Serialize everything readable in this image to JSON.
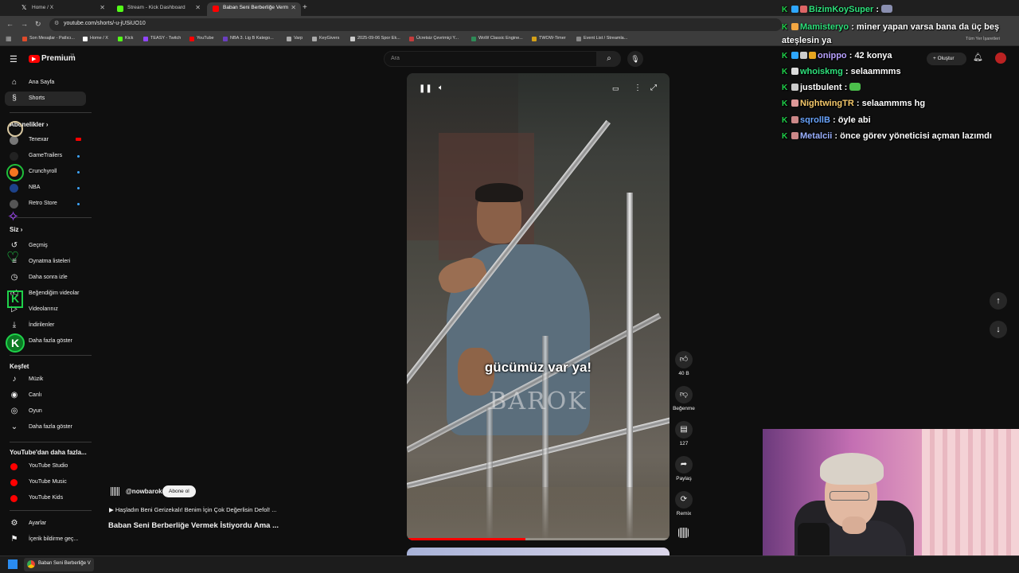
{
  "browser": {
    "tabs": [
      {
        "label": "Home / X",
        "color": "#ffffff"
      },
      {
        "label": "Stream - Kick Dashboard",
        "color": "#53fc18"
      },
      {
        "label": "Baban Seni Berberliğe Verm",
        "color": "#ff0000"
      }
    ],
    "url": "youtube.com/shorts/-u-jUSiUO10",
    "bookmarks": [
      {
        "label": "Son Mesajlar - Patlıcı...",
        "color": "#e04b2b"
      },
      {
        "label": "Home / X",
        "color": "#ffffff"
      },
      {
        "label": "Kick",
        "color": "#53fc18"
      },
      {
        "label": "TEASY - Twitch",
        "color": "#9146ff"
      },
      {
        "label": "YouTube",
        "color": "#ff0000"
      },
      {
        "label": "NBA 3. Lig B Katego...",
        "color": "#6a3fbf"
      },
      {
        "label": "Varp",
        "color": "#aaaaaa"
      },
      {
        "label": "KeyGivers",
        "color": "#aaaaaa"
      },
      {
        "label": "2025-09-06 Spor Ek...",
        "color": "#cccccc"
      },
      {
        "label": "Ücretsiz Çevrimiçi Y...",
        "color": "#c43c3c"
      },
      {
        "label": "WoW Classic Engine...",
        "color": "#2e8b57"
      },
      {
        "label": "TWOW-Timer",
        "color": "#d4a017"
      },
      {
        "label": "Event List / Streamla...",
        "color": "#888888"
      }
    ],
    "other_bookmarks": "Tüm Yer İşaretleri"
  },
  "youtube": {
    "logo": "Premium",
    "logo_sup": "TR",
    "search_placeholder": "Ara",
    "create_label": "Oluştur",
    "nav": [
      {
        "label": "Ana Sayfa",
        "icon": "home-icon"
      },
      {
        "label": "Shorts",
        "icon": "shorts-icon"
      }
    ],
    "subscriptions_heading": "Abonelikler",
    "subscriptions": [
      {
        "label": "Tenexar",
        "color": "#777777",
        "live": true
      },
      {
        "label": "GameTrailers",
        "color": "#222222",
        "live": false
      },
      {
        "label": "Crunchyroll",
        "color": "#f47521",
        "live": false
      },
      {
        "label": "NBA",
        "color": "#1d428a",
        "live": false
      },
      {
        "label": "Retro Store",
        "color": "#555555",
        "live": false
      }
    ],
    "you_heading": "Siz",
    "you_items": [
      {
        "label": "Geçmiş",
        "icon": "history-icon"
      },
      {
        "label": "Oynatma listeleri",
        "icon": "playlist-icon"
      },
      {
        "label": "Daha sonra izle",
        "icon": "clock-icon"
      },
      {
        "label": "Beğendiğim videolar",
        "icon": "thumbs-up-icon"
      },
      {
        "label": "Videolarınız",
        "icon": "video-icon"
      },
      {
        "label": "İndirilenler",
        "icon": "download-icon"
      },
      {
        "label": "Daha fazla göster",
        "icon": "chevron-down-icon"
      }
    ],
    "explore_heading": "Keşfet",
    "explore_items": [
      {
        "label": "Müzik",
        "icon": "music-icon"
      },
      {
        "label": "Canlı",
        "icon": "live-icon"
      },
      {
        "label": "Oyun",
        "icon": "game-icon"
      },
      {
        "label": "Daha fazla göster",
        "icon": "chevron-down-icon"
      }
    ],
    "more_heading": "YouTube'dan daha fazla...",
    "more_items": [
      {
        "label": "YouTube Studio"
      },
      {
        "label": "YouTube Music"
      },
      {
        "label": "YouTube Kids"
      }
    ],
    "settings_items": [
      {
        "label": "Ayarlar",
        "icon": "gear-icon"
      },
      {
        "label": "İçerik bildirme geç...",
        "icon": "flag-icon"
      }
    ]
  },
  "short": {
    "subtitle": "gücümüz var ya!",
    "watermark": "BAROK",
    "progress": 0.45,
    "channel": "@nowbarok",
    "subscribe": "Abone ol",
    "music": "Haşladın Beni Gerizekalı! Benim İçin Çok Değerlisin Defol! ...",
    "title": "Baban Seni Berberliğe Vermek İstiyordu Ama ...",
    "likes": "40 B",
    "dislike_label": "Beğenme",
    "comments": "127",
    "share_label": "Paylaş",
    "remix_label": "Remix"
  },
  "chat": [
    {
      "user": "BizimKoySuper",
      "color": "#2ee07b",
      "text": ""
    },
    {
      "user": "Mamisteryo",
      "color": "#2ee07b",
      "text": "miner yapan varsa bana da üç beş ateşlesin ya"
    },
    {
      "user": "onippo",
      "color": "#b9a1ff",
      "text": "42 konya"
    },
    {
      "user": "whoiskmg",
      "color": "#2ee07b",
      "text": "selaammms"
    },
    {
      "user": "justbulent",
      "color": "#ffffff",
      "text": ""
    },
    {
      "user": "NightwingTR",
      "color": "#f4c86a",
      "text": "selaammms hg"
    },
    {
      "user": "sqrollB",
      "color": "#6aa5ff",
      "text": "öyle abi"
    },
    {
      "user": "Metalcii",
      "color": "#9ab0ff",
      "text": "önce görev yöneticisi açman lazımdı"
    }
  ],
  "taskbar": {
    "app_label": "Baban Seni Berberliğe V"
  }
}
